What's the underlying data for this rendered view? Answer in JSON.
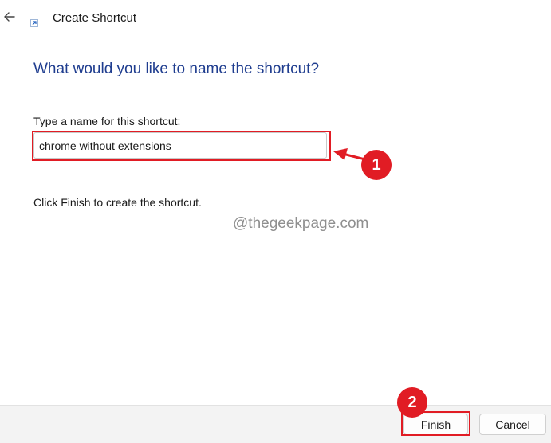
{
  "titlebar": {
    "title": "Create Shortcut",
    "back_icon": "back-arrow-icon",
    "app_icon": "shortcut-icon"
  },
  "main": {
    "heading": "What would you like to name the shortcut?",
    "field_label": "Type a name for this shortcut:",
    "shortcut_name_value": "chrome without extensions",
    "instruction": "Click Finish to create the shortcut."
  },
  "watermark": "@thegeekpage.com",
  "annotations": {
    "badge1": "1",
    "badge2": "2",
    "highlight_color": "#e11c24"
  },
  "footer": {
    "finish_label": "Finish",
    "cancel_label": "Cancel"
  },
  "colors": {
    "heading": "#1f3d8f",
    "footer_bg": "#f3f3f3",
    "annotation_red": "#e11c24"
  }
}
